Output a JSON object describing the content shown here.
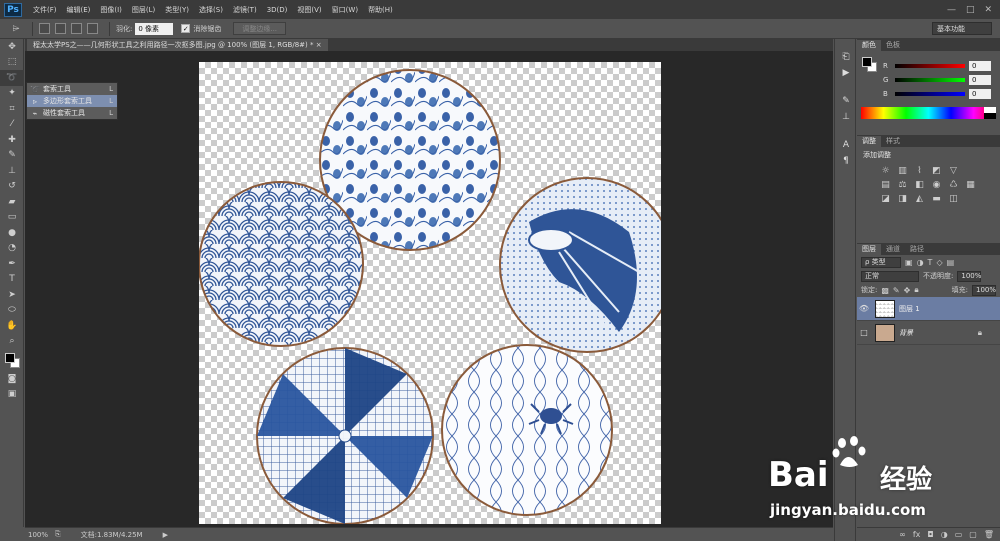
{
  "app": {
    "logo": "Ps",
    "menus": [
      "文件(F)",
      "编辑(E)",
      "图像(I)",
      "图层(L)",
      "类型(Y)",
      "选择(S)",
      "滤镜(T)",
      "3D(D)",
      "视图(V)",
      "窗口(W)",
      "帮助(H)"
    ],
    "window_controls": [
      "—",
      "□",
      "✕"
    ]
  },
  "options_bar": {
    "feather_label": "羽化:",
    "feather_value": "0 像素",
    "antialias_label": "消除锯齿",
    "antialias_checked": true,
    "refine_edge": "调整边缘...",
    "workspace": "基本功能"
  },
  "document": {
    "tab_title": "程太太学PS之——几何形状工具之利用路径一次抠多图.jpg @ 100% (图层 1, RGB/8#) *",
    "zoom": "100%",
    "doc_size": "文档:1.83M/4.25M"
  },
  "tool_flyout": {
    "items": [
      {
        "label": "套索工具",
        "key": "L",
        "icon": "lasso-icon",
        "selected": false
      },
      {
        "label": "多边形套索工具",
        "key": "L",
        "icon": "polygonal-lasso-icon",
        "selected": true
      },
      {
        "label": "磁性套索工具",
        "key": "L",
        "icon": "magnetic-lasso-icon",
        "selected": false
      }
    ]
  },
  "color_panel": {
    "tabs": [
      "颜色",
      "色板"
    ],
    "channels": [
      {
        "label": "R",
        "value": "0"
      },
      {
        "label": "G",
        "value": "0"
      },
      {
        "label": "B",
        "value": "0"
      }
    ]
  },
  "adjustments_panel": {
    "tabs": [
      "调整",
      "样式"
    ],
    "title": "添加调整"
  },
  "layers_panel": {
    "tabs": [
      "图层",
      "通道",
      "路径"
    ],
    "filter_kind": "ρ 类型",
    "blend_mode": "正常",
    "opacity_label": "不透明度:",
    "opacity_value": "100%",
    "lock_label": "锁定:",
    "fill_label": "填充:",
    "fill_value": "100%",
    "layers": [
      {
        "name": "图层 1",
        "visible": true,
        "active": true,
        "locked": false
      },
      {
        "name": "背景",
        "visible": false,
        "active": false,
        "locked": true
      }
    ]
  },
  "watermark": {
    "brand_latin": "Bai",
    "brand_cn": "经验",
    "url": "jingyan.baidu.com"
  }
}
